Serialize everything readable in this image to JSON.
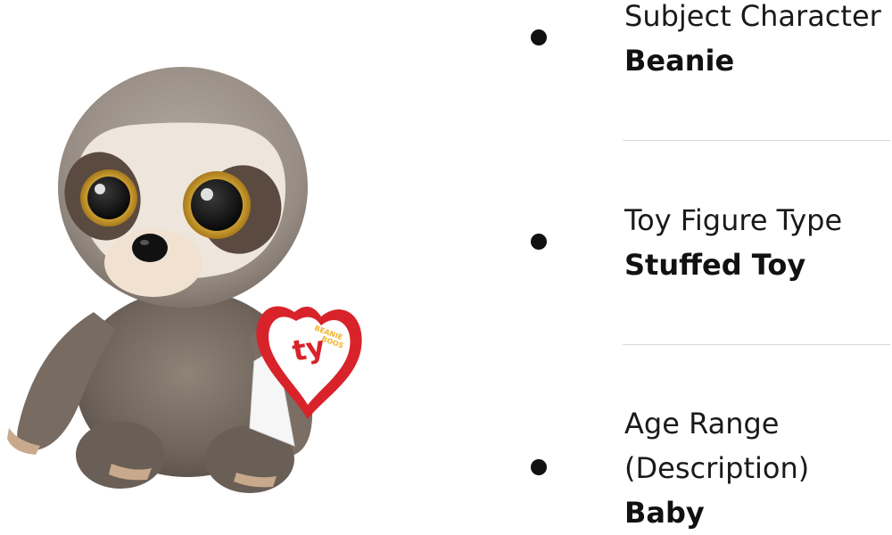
{
  "product": {
    "image_name": "sloth-plush-toy"
  },
  "attributes": [
    {
      "label": "Subject Character",
      "value": "Beanie"
    },
    {
      "label": "Toy Figure Type",
      "value": "Stuffed Toy"
    },
    {
      "label": "Age Range (Description)",
      "value": "Baby"
    }
  ],
  "tag": {
    "brand": "ty",
    "line": "BEANIE BOOS"
  },
  "colors": {
    "text": "#1a1a1a",
    "divider": "#d5d9d9",
    "fur": "#7d7168",
    "tag_red": "#d8232a"
  }
}
